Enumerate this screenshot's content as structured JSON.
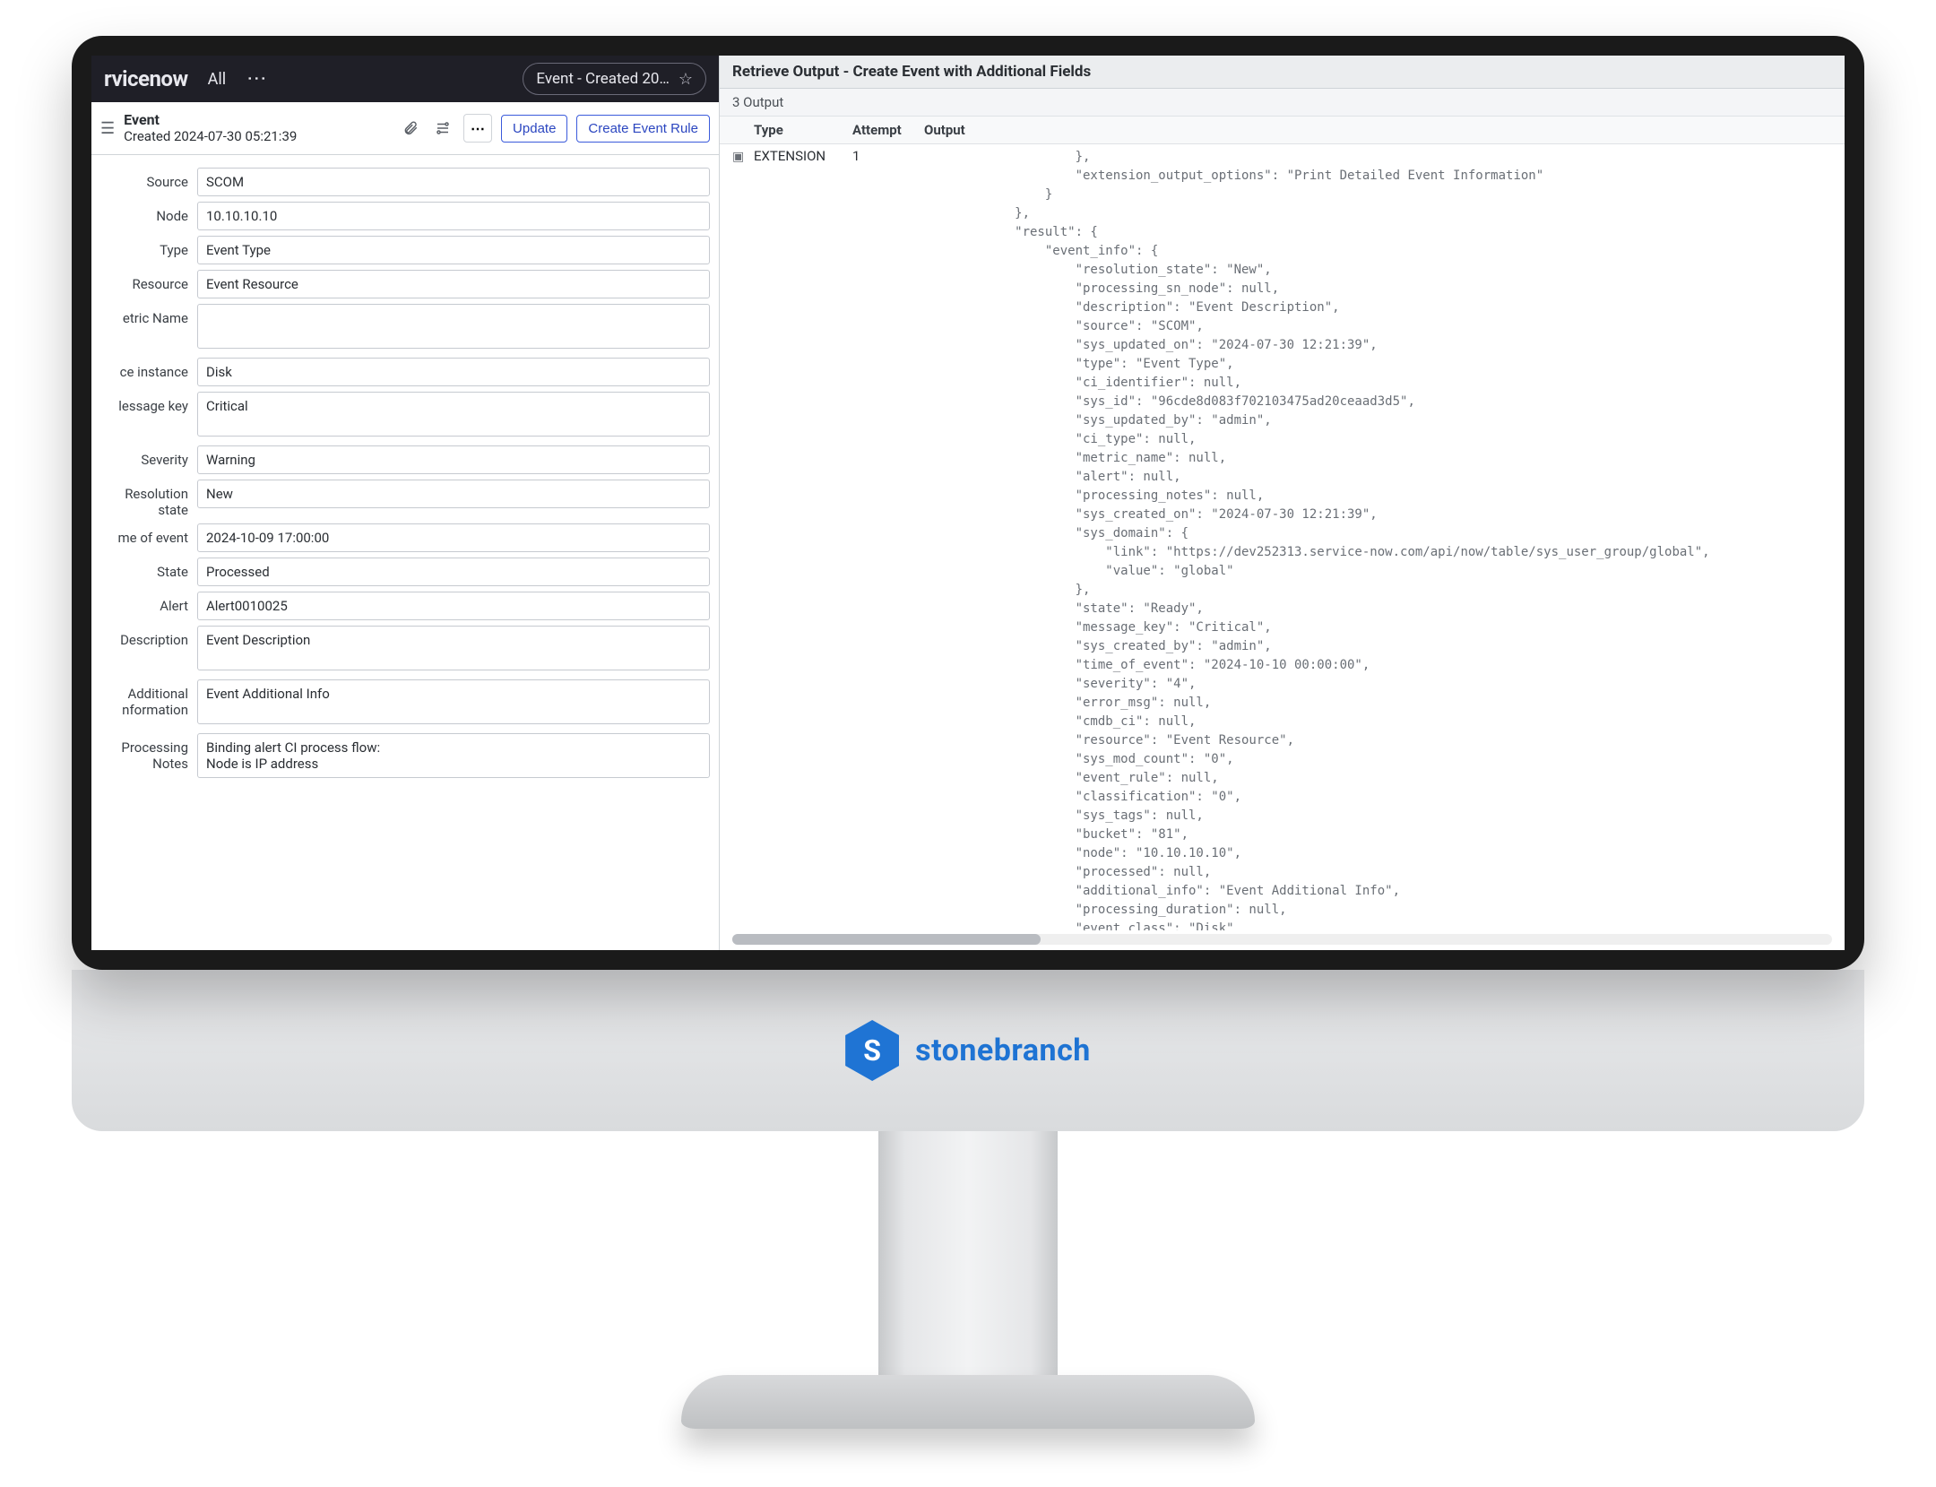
{
  "brand": {
    "badge_letter": "S",
    "name": "stonebranch"
  },
  "sn": {
    "logo": "rvicenow",
    "all": "All",
    "tab_label": "Event - Created 20…",
    "title_line1": "Event",
    "title_line2": "Created 2024-07-30 05:21:39",
    "btn_update": "Update",
    "btn_create_rule": "Create Event Rule"
  },
  "fields": {
    "source": {
      "label": "Source",
      "value": "SCOM"
    },
    "node": {
      "label": "Node",
      "value": "10.10.10.10"
    },
    "type": {
      "label": "Type",
      "value": "Event Type"
    },
    "resource": {
      "label": "Resource",
      "value": "Event Resource"
    },
    "metric": {
      "label": "etric Name",
      "value": ""
    },
    "instance": {
      "label": "ce instance",
      "value": "Disk"
    },
    "msgkey": {
      "label": "lessage key",
      "value": "Critical"
    },
    "severity": {
      "label": "Severity",
      "value": "Warning"
    },
    "resstate": {
      "label": "Resolution state",
      "value": "New"
    },
    "toe": {
      "label": "me of event",
      "value": "2024-10-09 17:00:00"
    },
    "state": {
      "label": "State",
      "value": "Processed"
    },
    "alert": {
      "label": "Alert",
      "value": "Alert0010025"
    },
    "desc": {
      "label": "Description",
      "value": "Event Description"
    },
    "addl": {
      "label": "Additional nformation",
      "value": "Event Additional Info"
    },
    "proc": {
      "label": "Processing Notes",
      "value": "Binding alert CI process flow:\nNode is IP address"
    }
  },
  "output": {
    "title": "Retrieve Output - Create Event with Additional Fields",
    "sub": "3 Output",
    "headers": {
      "type": "Type",
      "attempt": "Attempt",
      "output": "Output"
    },
    "row": {
      "type": "EXTENSION",
      "attempt": "1"
    },
    "json": "                    },\n                    \"extension_output_options\": \"Print Detailed Event Information\"\n                }\n            },\n            \"result\": {\n                \"event_info\": {\n                    \"resolution_state\": \"New\",\n                    \"processing_sn_node\": null,\n                    \"description\": \"Event Description\",\n                    \"source\": \"SCOM\",\n                    \"sys_updated_on\": \"2024-07-30 12:21:39\",\n                    \"type\": \"Event Type\",\n                    \"ci_identifier\": null,\n                    \"sys_id\": \"96cde8d083f702103475ad20ceaad3d5\",\n                    \"sys_updated_by\": \"admin\",\n                    \"ci_type\": null,\n                    \"metric_name\": null,\n                    \"alert\": null,\n                    \"processing_notes\": null,\n                    \"sys_created_on\": \"2024-07-30 12:21:39\",\n                    \"sys_domain\": {\n                        \"link\": \"https://dev252313.service-now.com/api/now/table/sys_user_group/global\",\n                        \"value\": \"global\"\n                    },\n                    \"state\": \"Ready\",\n                    \"message_key\": \"Critical\",\n                    \"sys_created_by\": \"admin\",\n                    \"time_of_event\": \"2024-10-10 00:00:00\",\n                    \"severity\": \"4\",\n                    \"error_msg\": null,\n                    \"cmdb_ci\": null,\n                    \"resource\": \"Event Resource\",\n                    \"sys_mod_count\": \"0\",\n                    \"event_rule\": null,\n                    \"classification\": \"0\",\n                    \"sys_tags\": null,\n                    \"bucket\": \"81\",\n                    \"node\": \"10.10.10.10\",\n                    \"processed\": null,\n                    \"additional_info\": \"Event Additional Info\",\n                    \"processing_duration\": null,\n                    \"event class\": \"Disk\""
  }
}
